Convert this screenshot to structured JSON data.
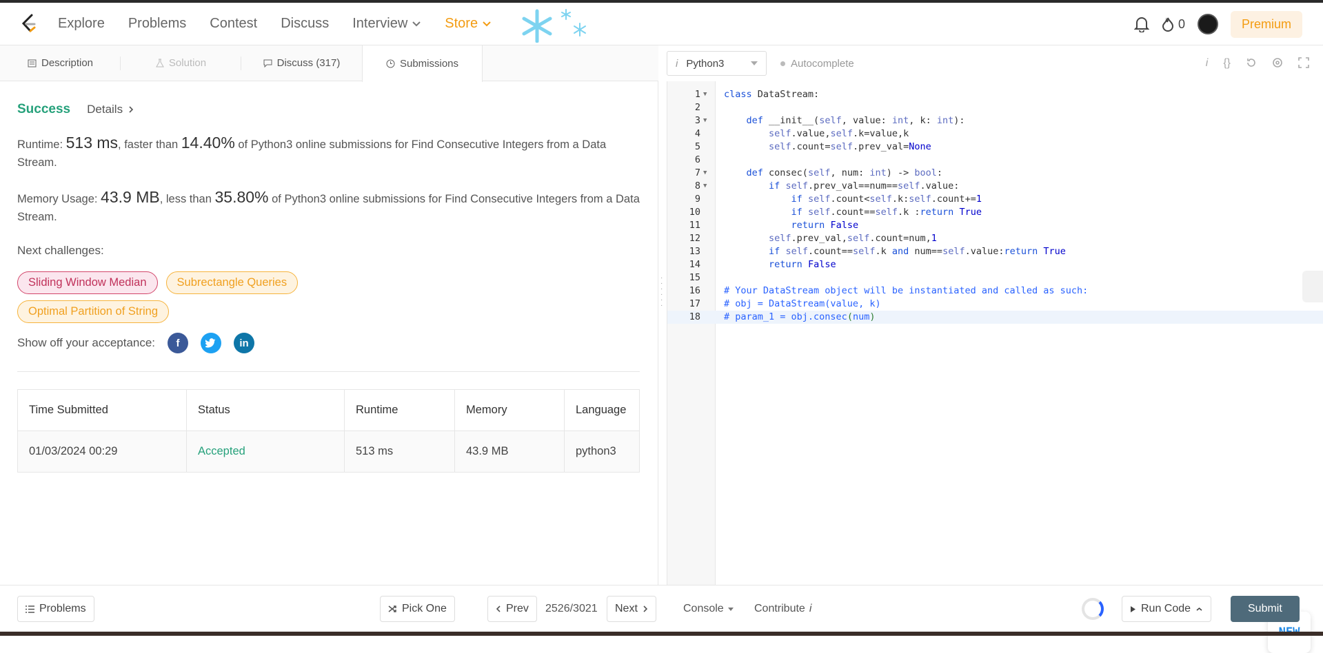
{
  "nav": {
    "items": [
      "Explore",
      "Problems",
      "Contest",
      "Discuss"
    ],
    "interview": "Interview",
    "store": "Store",
    "streak_count": "0",
    "premium": "Premium"
  },
  "tabs": {
    "description": "Description",
    "solution": "Solution",
    "discuss": "Discuss (317)",
    "submissions": "Submissions"
  },
  "result": {
    "status": "Success",
    "details": "Details",
    "runtime_label": "Runtime: ",
    "runtime_value": "513 ms",
    "runtime_mid": ", faster than ",
    "runtime_pct": "14.40%",
    "runtime_tail": " of Python3 online submissions for Find Consecutive Integers from a Data Stream.",
    "memory_label": "Memory Usage: ",
    "memory_value": "43.9 MB",
    "memory_mid": ", less than ",
    "memory_pct": "35.80%",
    "memory_tail": " of Python3 online submissions for Find Consecutive Integers from a Data Stream.",
    "next_label": "Next challenges:",
    "challenges": [
      "Sliding Window Median",
      "Subrectangle Queries",
      "Optimal Partition of String"
    ],
    "share_label": "Show off your acceptance:"
  },
  "table": {
    "headers": [
      "Time Submitted",
      "Status",
      "Runtime",
      "Memory",
      "Language"
    ],
    "row": [
      "01/03/2024 00:29",
      "Accepted",
      "513 ms",
      "43.9 MB",
      "python3"
    ]
  },
  "editor": {
    "language": "Python3",
    "autocomplete": "Autocomplete",
    "new_badge": "NEW"
  },
  "footer": {
    "problems": "Problems",
    "pick_one": "Pick One",
    "prev": "Prev",
    "counter": "2526/3021",
    "next": "Next",
    "console": "Console",
    "contribute": "Contribute",
    "run_code": "Run Code",
    "submit": "Submit"
  }
}
